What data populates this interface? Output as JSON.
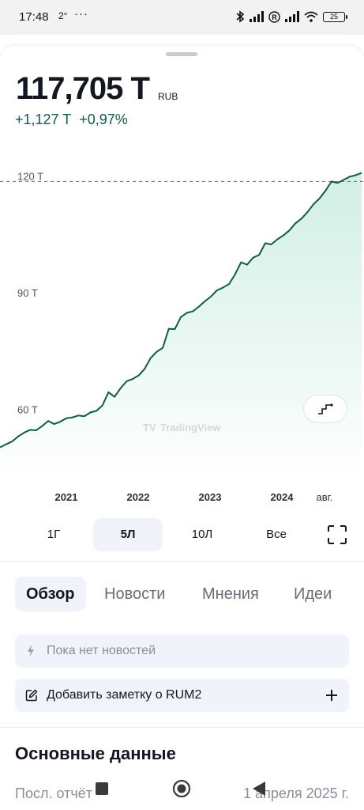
{
  "status_bar": {
    "time": "17:48",
    "temperature": "2°",
    "dots": "···",
    "battery": "25"
  },
  "header": {
    "price": "117,705 T",
    "currency": "RUB",
    "change_abs": "+1,127 T",
    "change_pct": "+0,97%"
  },
  "chart_data": {
    "type": "area",
    "x": [
      0,
      1,
      2,
      3,
      4,
      5,
      6,
      7,
      8,
      9,
      10,
      11,
      12,
      13,
      14,
      15,
      16,
      17,
      18,
      19,
      20,
      21,
      22,
      23,
      24,
      25,
      26,
      27,
      28,
      29,
      30,
      31,
      32,
      33,
      34,
      35,
      36,
      37,
      38,
      39,
      40,
      41,
      42,
      43,
      44,
      45,
      46,
      47,
      48,
      49,
      50,
      51,
      52,
      53,
      54,
      55,
      56,
      57,
      58,
      59,
      60
    ],
    "x_tick_labels": [
      "2021",
      "2022",
      "2023",
      "2024",
      "авг."
    ],
    "y_tick_labels": [
      "120 T",
      "90 T",
      "60 T"
    ],
    "y_ticks": [
      120,
      90,
      60
    ],
    "ylim": [
      45,
      128
    ],
    "values": [
      52.0,
      52.8,
      53.5,
      54.8,
      55.8,
      56.5,
      56.4,
      57.5,
      58.8,
      58.0,
      58.6,
      59.5,
      59.7,
      60.2,
      60.0,
      61.0,
      61.4,
      62.8,
      66.2,
      65.0,
      67.2,
      69.0,
      69.6,
      70.5,
      72.2,
      75.0,
      76.6,
      77.6,
      82.5,
      82.4,
      85.5,
      86.6,
      87.0,
      88.2,
      89.6,
      90.8,
      92.4,
      93.1,
      94.0,
      96.5,
      99.6,
      99.0,
      100.8,
      101.5,
      104.5,
      104.2,
      105.5,
      106.5,
      107.8,
      109.6,
      110.8,
      112.5,
      114.5,
      116.0,
      118.0,
      120.4,
      120.0,
      120.8,
      121.6,
      122.0,
      122.6
    ],
    "reference_line": 120.4,
    "line_color": "#0c5e46",
    "fill_color": "#cfeee4",
    "watermark": "TradingView"
  },
  "range_buttons": [
    {
      "label": "1Г",
      "active": false
    },
    {
      "label": "5Л",
      "active": true
    },
    {
      "label": "10Л",
      "active": false
    },
    {
      "label": "Все",
      "active": false
    }
  ],
  "tabs": [
    {
      "label": "Обзор",
      "active": true
    },
    {
      "label": "Новости",
      "active": false
    },
    {
      "label": "Мнения",
      "active": false
    },
    {
      "label": "Идеи",
      "active": false
    }
  ],
  "news": {
    "placeholder": "Пока нет новостей"
  },
  "note": {
    "label": "Добавить заметку о RUM2"
  },
  "fundamentals": {
    "title": "Основные данные",
    "rows": [
      {
        "label": "Посл. отчёт",
        "value": "1 апреля 2025 г."
      }
    ]
  },
  "colors": {
    "accent": "#0c5e46",
    "tab_active_bg": "#f0f3fa"
  }
}
